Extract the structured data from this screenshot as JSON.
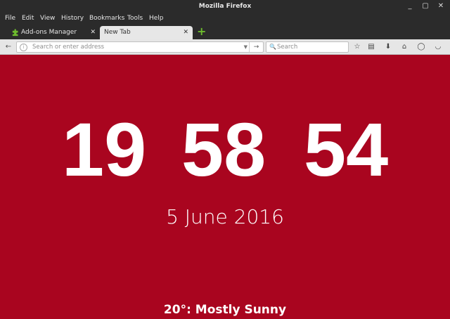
{
  "window": {
    "title": "Mozilla Firefox"
  },
  "menu": [
    {
      "id": "file",
      "label": "File"
    },
    {
      "id": "edit",
      "label": "Edit"
    },
    {
      "id": "view",
      "label": "View"
    },
    {
      "id": "history",
      "label": "History"
    },
    {
      "id": "bookmarks",
      "label": "Bookmarks"
    },
    {
      "id": "tools",
      "label": "Tools"
    },
    {
      "id": "help",
      "label": "Help"
    }
  ],
  "tabs": [
    {
      "label": "Add-ons Manager",
      "icon": "puzzle-icon",
      "active": false
    },
    {
      "label": "New Tab",
      "active": true
    }
  ],
  "urlbar": {
    "placeholder": "Search or enter address"
  },
  "searchbar": {
    "placeholder": "Search"
  },
  "page": {
    "clock": {
      "hours": "19",
      "minutes": "58",
      "seconds": "54"
    },
    "date": "5 June 2016",
    "weather": "20°: Mostly Sunny"
  },
  "colors": {
    "background": "#a9051f",
    "chrome": "#2b2b2b",
    "toolbar": "#e6e6e6",
    "newtab_plus": "#6dbb2d"
  }
}
